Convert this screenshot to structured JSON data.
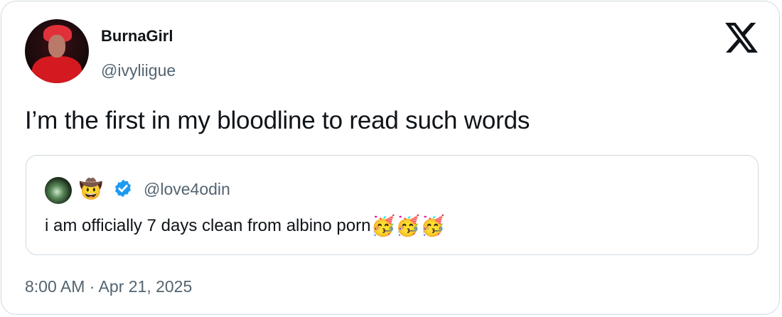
{
  "author": {
    "display_name": "BurnaGirl",
    "handle": "@ivyliigue"
  },
  "tweet": {
    "text": "I’m the first in my bloodline to read such words",
    "timestamp": "8:00 AM · Apr 21, 2025"
  },
  "quoted": {
    "emoji": "🤠",
    "handle": "@love4odin",
    "text": "i am officially 7 days clean from albino porn",
    "trailing_emoji": "🥳🥳🥳",
    "verified_color": "#1d9bf0"
  },
  "icons": {
    "brand": "x-logo-icon",
    "verified": "verified-badge-icon"
  }
}
